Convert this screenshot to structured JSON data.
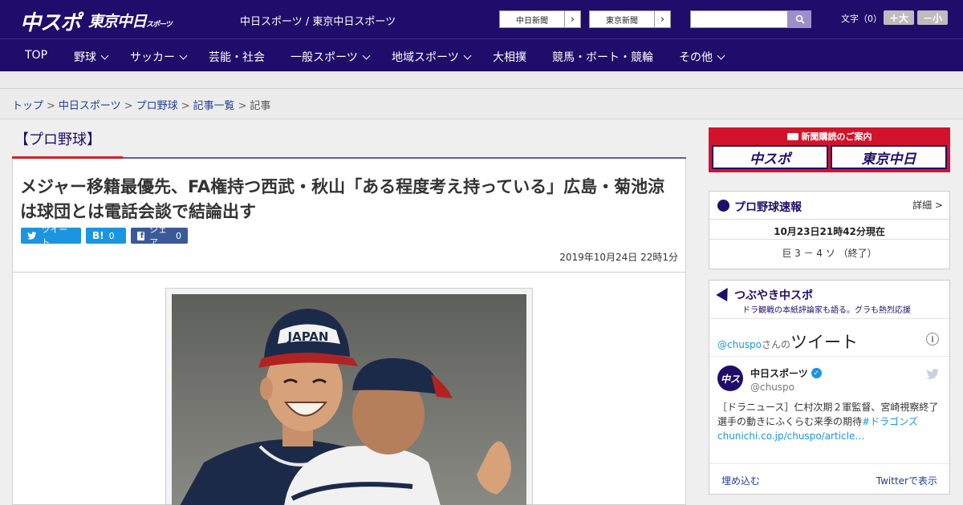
{
  "header": {
    "logo_main": "中スポ",
    "logo_sub": "東京中日",
    "logo_sub_small": "スポーツ",
    "site_names": "中日スポーツ / 東京中日スポーツ",
    "paper_links": [
      {
        "label": "中日新聞"
      },
      {
        "label": "東京新聞"
      }
    ],
    "search_placeholder": "",
    "font_size_label": "文字（0）",
    "font_bigger": "＋大",
    "font_smaller": "－小"
  },
  "nav": {
    "items": [
      {
        "label": "TOP",
        "has_menu": false
      },
      {
        "label": "野球",
        "has_menu": true
      },
      {
        "label": "サッカー",
        "has_menu": true
      },
      {
        "label": "芸能・社会",
        "has_menu": false
      },
      {
        "label": "一般スポーツ",
        "has_menu": true
      },
      {
        "label": "地域スポーツ",
        "has_menu": true
      },
      {
        "label": "大相撲",
        "has_menu": false
      },
      {
        "label": "競馬・ボート・競輪",
        "has_menu": false
      },
      {
        "label": "その他",
        "has_menu": true
      }
    ]
  },
  "breadcrumb": {
    "items": [
      "トップ",
      "中日スポーツ",
      "プロ野球",
      "記事一覧"
    ],
    "current": "記事",
    "separator": ">"
  },
  "article": {
    "category": "【プロ野球】",
    "headline": "メジャー移籍最優先、FA権持つ西武・秋山「ある程度考え持っている」広島・菊池涼は球団とは電話会談で結論出す",
    "share": {
      "tweet_label": "ツイート",
      "hatena_label": "B!",
      "hatena_count": "0",
      "facebook_label": "シェア",
      "facebook_count": "0"
    },
    "date": "2019年10月24日 22時1分",
    "photo_cap_text": "JAPAN"
  },
  "sidebar": {
    "subscription": {
      "title": "新聞購読のご案内",
      "logo_left": "中スポ",
      "logo_right": "東京中日"
    },
    "scores": {
      "title": "プロ野球速報",
      "more": "詳細 >",
      "as_of": "10月23日21時42分現在",
      "games": [
        "巨 3 － 4 ソ （終了）"
      ]
    },
    "twitter": {
      "title": "つぶやき中スポ",
      "subtitle": "ドラ観戦の本紙評論家も語る。グラも熱烈応援",
      "handle_prefix": "@chuspo",
      "handle_suffix": "さんの",
      "tweets_label": "ツイート",
      "account_name": "中日スポーツ",
      "account_handle": "@chuspo",
      "tweet_text": "［ドラニュース］仁村次期２軍監督、宮崎視察終了　選手の動きにふくらむ来季の期待",
      "tweet_link": "#ドラゴンズchunichi.co.jp/chuspo/article…",
      "embed_label": "埋め込む",
      "view_label": "Twitterで表示"
    }
  },
  "colors": {
    "brand_navy": "#1f0d6b",
    "accent_red": "#d2222a",
    "twitter_blue": "#1b95e0",
    "facebook_blue": "#3b5998",
    "link_blue": "#1e3f9a"
  }
}
